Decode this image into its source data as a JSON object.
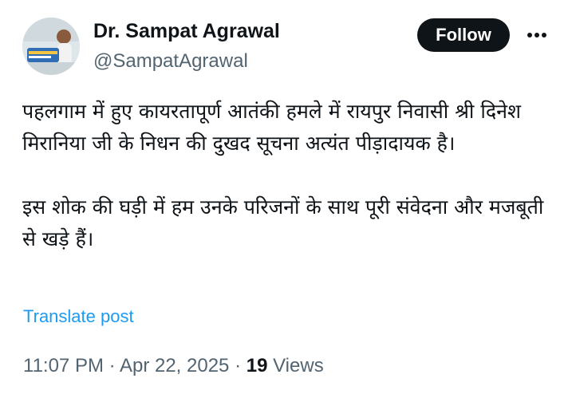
{
  "author": {
    "display_name": "Dr. Sampat Agrawal",
    "handle": "@SampatAgrawal",
    "avatar_icon": "profile-photo"
  },
  "actions": {
    "follow_label": "Follow",
    "more_icon": "ellipsis-icon"
  },
  "post": {
    "text": "पहलगाम में हुए कायरतापूर्ण आतंकी हमले में रायपुर निवासी श्री दिनेश मिरानिया जी के निधन की दुखद सूचना अत्यंत पीड़ादायक है।\n\nइस शोक की घड़ी में हम उनके परिजनों के साथ पूरी संवेदना और मजबूती से खड़े हैं।",
    "translate_label": "Translate post"
  },
  "meta": {
    "time": "11:07 PM",
    "separator": " · ",
    "date": "Apr 22, 2025",
    "views_count": "19",
    "views_label": "Views"
  },
  "colors": {
    "text": "#0f1419",
    "secondary": "#536471",
    "link": "#1d9bf0",
    "button_bg": "#0f1419"
  }
}
